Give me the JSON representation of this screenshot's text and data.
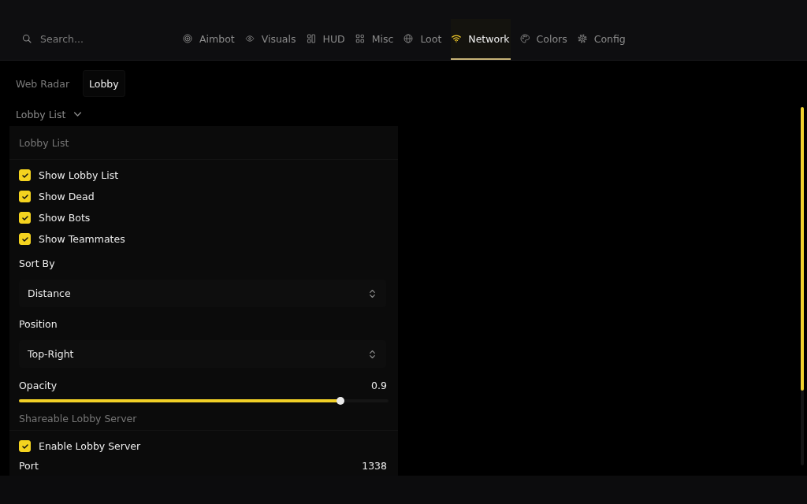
{
  "search": {
    "placeholder": "Search..."
  },
  "nav_tabs": [
    {
      "label": "Aimbot",
      "selected": false
    },
    {
      "label": "Visuals",
      "selected": false
    },
    {
      "label": "HUD",
      "selected": false
    },
    {
      "label": "Misc",
      "selected": false
    },
    {
      "label": "Loot",
      "selected": false
    },
    {
      "label": "Network",
      "selected": true
    },
    {
      "label": "Colors",
      "selected": false
    },
    {
      "label": "Config",
      "selected": false
    }
  ],
  "sub_tabs": [
    {
      "label": "Web Radar",
      "selected": false
    },
    {
      "label": "Lobby",
      "selected": true
    }
  ],
  "section_toggle": {
    "label": "Lobby List",
    "expanded": true
  },
  "panel": {
    "items": [
      {
        "kind": "header",
        "label": "Lobby List"
      },
      {
        "kind": "checkbox",
        "label": "Show Lobby List",
        "checked": true
      },
      {
        "kind": "checkbox",
        "label": "Show Dead",
        "checked": true
      },
      {
        "kind": "checkbox",
        "label": "Show Bots",
        "checked": true
      },
      {
        "kind": "checkbox",
        "label": "Show Teammates",
        "checked": true
      },
      {
        "kind": "select",
        "label": "Sort By",
        "value": "Distance"
      },
      {
        "kind": "select",
        "label": "Position",
        "value": "Top-Right"
      },
      {
        "kind": "slider",
        "label": "Opacity",
        "reading": "0.9",
        "level": 0.87
      },
      {
        "kind": "header",
        "label": "Shareable Lobby Server"
      },
      {
        "kind": "checkbox",
        "label": "Enable Lobby Server",
        "checked": true
      },
      {
        "kind": "value",
        "label": "Port",
        "value": "1338"
      }
    ]
  }
}
